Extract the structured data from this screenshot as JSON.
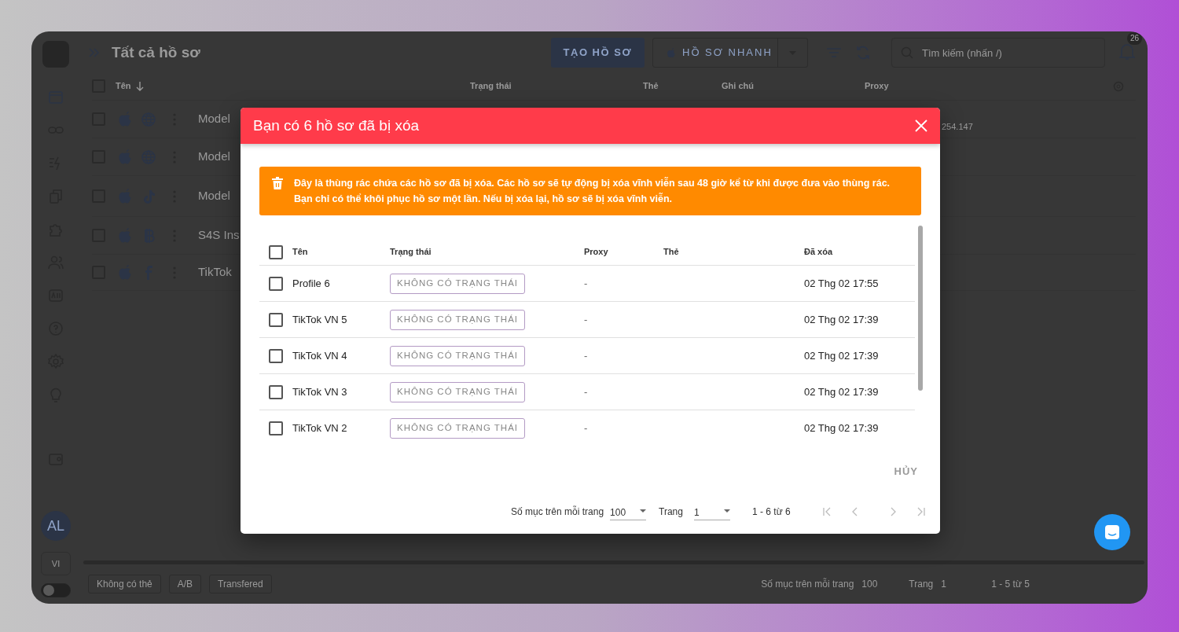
{
  "app": {
    "page_title": "Tất cả hồ sơ",
    "create_button": "TẠO HỒ SƠ",
    "quick_button": "HỒ SƠ NHANH",
    "search": {
      "placeholder": "Tìm kiếm (nhấn /)"
    },
    "notification_count": "26",
    "columns": [
      "Tên",
      "Trạng thái",
      "Thẻ",
      "Ghi chú",
      "Proxy"
    ],
    "select_all": false,
    "rows": [
      {
        "name": "Model",
        "kind": "web",
        "checked": false
      },
      {
        "name": "Model",
        "kind": "web",
        "checked": false
      },
      {
        "name": "Model",
        "kind": "tiktok",
        "checked": false
      },
      {
        "name": "S4S Ins",
        "kind": "bitcoin",
        "checked": false
      },
      {
        "name": "TikTok",
        "kind": "facebook",
        "checked": false
      }
    ],
    "proxy_fragment": "254.147",
    "avatar": "AL",
    "language": "VI",
    "dark_mode": false,
    "tags": [
      "Không có thẻ",
      "A/B",
      "Transfered"
    ],
    "pagination": {
      "label": "Số mục trên mỗi trang",
      "per_page": "100",
      "page_label": "Trang",
      "page": "1",
      "range": "1 - 5 từ 5"
    }
  },
  "dialog": {
    "title": "Bạn có 6 hồ sơ đã bị xóa",
    "alert": "Đây là thùng rác chứa các hồ sơ đã bị xóa. Các hồ sơ sẽ tự động bị xóa vĩnh viễn sau 48 giờ kể từ khi được đưa vào thùng rác. Bạn chỉ có thể khôi phục hồ sơ một lần. Nếu bị xóa lại, hồ sơ sẽ bị xóa vĩnh viễn.",
    "columns": [
      "Tên",
      "Trạng thái",
      "Proxy",
      "Thẻ",
      "Đã xóa"
    ],
    "select_all": false,
    "rows": [
      {
        "name": "Profile 6",
        "status": "KHÔNG CÓ TRẠNG THÁI",
        "proxy": "-",
        "deleted": "02 Thg 02 17:55",
        "checked": false
      },
      {
        "name": "TikTok VN 5",
        "status": "KHÔNG CÓ TRẠNG THÁI",
        "proxy": "-",
        "deleted": "02 Thg 02 17:39",
        "checked": false
      },
      {
        "name": "TikTok VN 4",
        "status": "KHÔNG CÓ TRẠNG THÁI",
        "proxy": "-",
        "deleted": "02 Thg 02 17:39",
        "checked": false
      },
      {
        "name": "TikTok VN 3",
        "status": "KHÔNG CÓ TRẠNG THÁI",
        "proxy": "-",
        "deleted": "02 Thg 02 17:39",
        "checked": false
      },
      {
        "name": "TikTok VN 2",
        "status": "KHÔNG CÓ TRẠNG THÁI",
        "proxy": "-",
        "deleted": "02 Thg 02 17:39",
        "checked": false
      }
    ],
    "cancel_button": "HỦY",
    "pagination": {
      "label": "Số mục trên mỗi trang",
      "per_page": "100",
      "page_label": "Trang",
      "page": "1",
      "range": "1 - 6 từ 6"
    }
  }
}
